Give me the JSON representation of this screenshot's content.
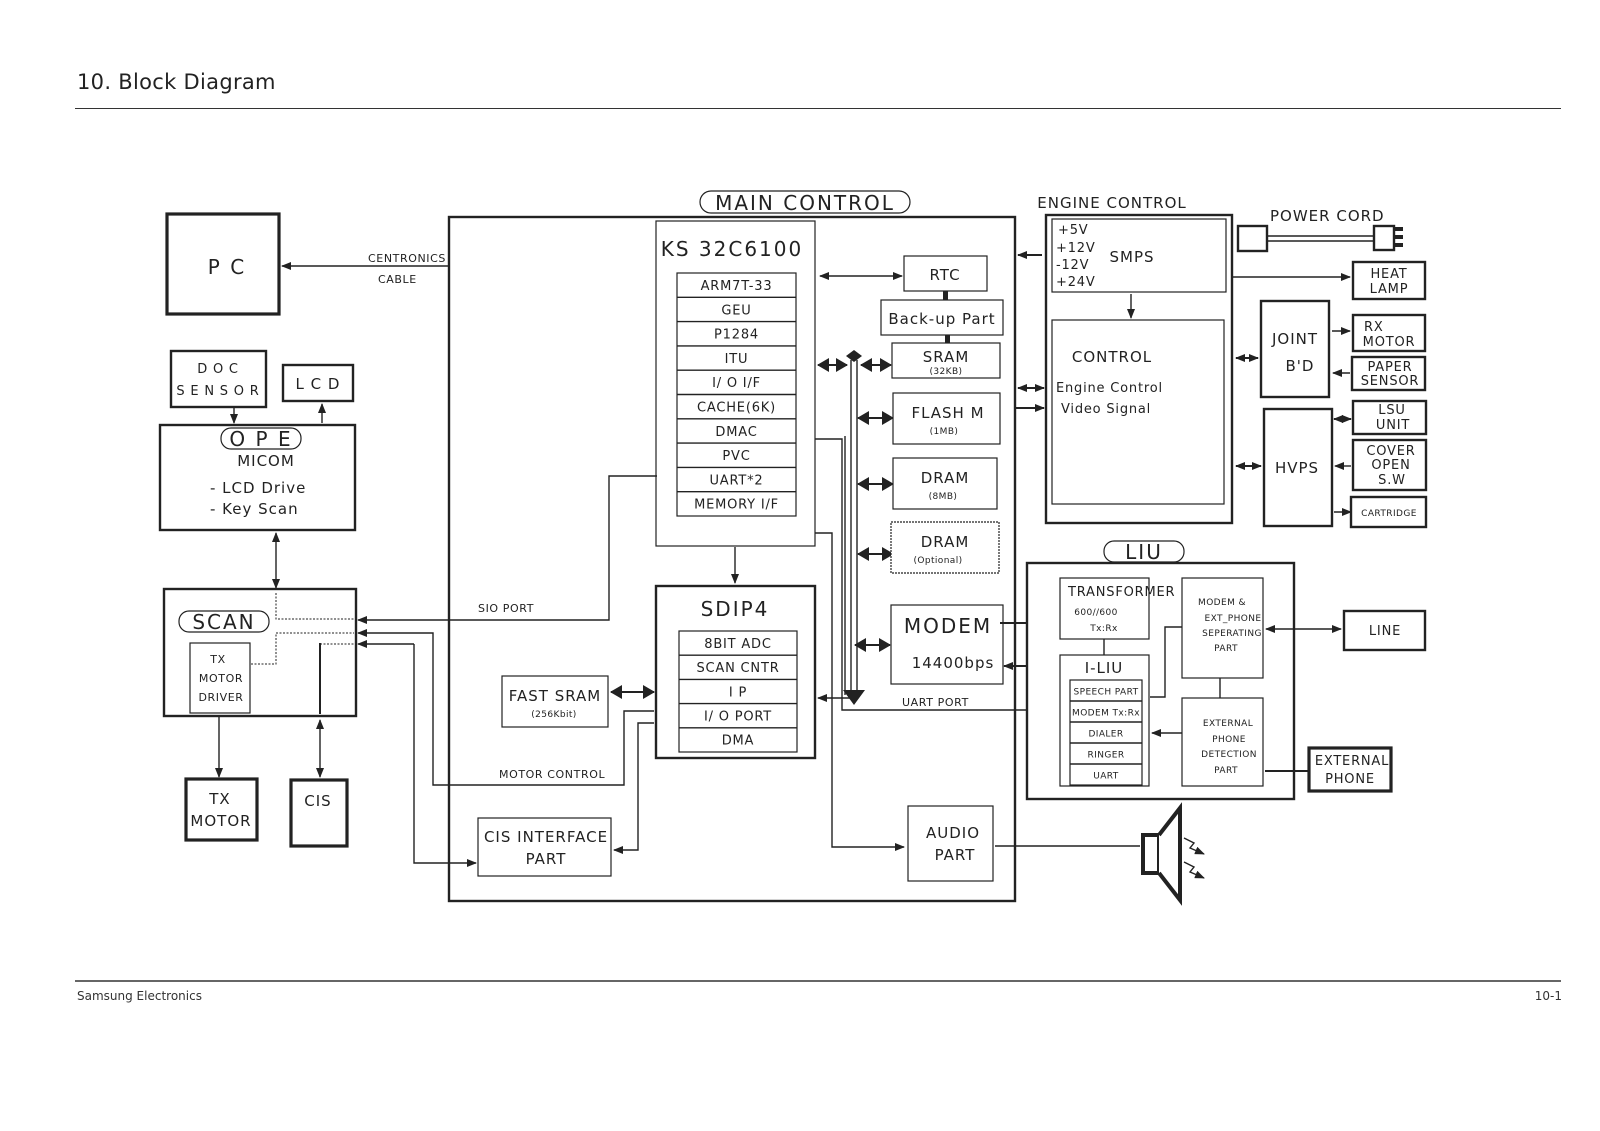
{
  "page": {
    "title": "10.  Block Diagram",
    "footer_left": "Samsung Electronics",
    "footer_right": "10-1"
  },
  "diagram": {
    "pc": "P C",
    "centronics_line1": "CENTRONICS",
    "centronics_line2": "CABLE",
    "doc_sensor_line1": "D O C",
    "doc_sensor_line2": "S E N S O R",
    "lcd": "L C D",
    "ope": {
      "title": "O P E",
      "micom": "MICOM",
      "items": [
        "- LCD  Drive",
        "-  Key Scan"
      ]
    },
    "scan": {
      "title": "SCAN",
      "tx_motor_driver": [
        "TX",
        "MOTOR",
        "DRIVER"
      ]
    },
    "tx_motor": [
      "TX",
      "MOTOR"
    ],
    "cis": "CIS",
    "main_control": {
      "title": "MAIN  CONTROL",
      "cpu": {
        "title": "KS 32C6100",
        "items": [
          "ARM7T-33",
          "GEU",
          "P1284",
          "ITU",
          "I/ O I/F",
          "CACHE(6K)",
          "DMAC",
          "PVC",
          "UART*2",
          "MEMORY I/F"
        ]
      },
      "rtc": "RTC",
      "backup": "Back-up  Part",
      "sram": {
        "title": "SRAM",
        "size": "(32KB)"
      },
      "flash": {
        "title": "FLASH  M",
        "size": "(1MB)"
      },
      "dram": {
        "title": "DRAM",
        "size": "(8MB)"
      },
      "dram_opt": {
        "title": "DRAM",
        "size": "(Optional)"
      },
      "modem": {
        "title": "MODEM",
        "speed": "14400bps"
      },
      "sdip4": {
        "title": "SDIP4",
        "items": [
          "8BIT ADC",
          "SCAN CNTR",
          "I  P",
          "I/ O PORT",
          "DMA"
        ]
      },
      "fast_sram": {
        "title": "FAST  SRAM",
        "size": "(256Kbit)"
      },
      "cis_interface": [
        "CIS INTERFACE",
        "PART"
      ],
      "audio": [
        "AUDIO",
        "PART"
      ],
      "sio_port": "SIO PORT",
      "motor_control": "MOTOR  CONTROL",
      "uart_port": "UART PORT"
    },
    "engine_control": {
      "title": "ENGINE  CONTROL",
      "smps": {
        "title": "SMPS",
        "voltages": [
          "+5V",
          "+12V",
          "-12V",
          "+24V"
        ]
      },
      "control": {
        "title": "CONTROL",
        "lines": [
          "Engine  Control",
          "Video  Signal"
        ]
      }
    },
    "power_cord": "POWER  CORD",
    "heat_lamp": [
      "HEAT",
      "LAMP"
    ],
    "joint_bd": [
      "JOINT",
      "B'D"
    ],
    "rx_motor": [
      "RX",
      "MOTOR"
    ],
    "paper_sensor": [
      "PAPER",
      "SENSOR"
    ],
    "hvps": "HVPS",
    "lsu_unit": [
      "LSU",
      "UNIT"
    ],
    "cover_open": [
      "COVER",
      "OPEN",
      "S.W"
    ],
    "cartridge": "CARTRIDGE",
    "liu": {
      "title": "LIU",
      "transformer": [
        "TRANSFORMER",
        "600//600",
        "Tx:Rx"
      ],
      "iliu": {
        "title": "I-LIU",
        "items": [
          "SPEECH PART",
          "MODEM Tx:Rx",
          "DIALER",
          "RINGER",
          "UART"
        ]
      },
      "separating": [
        "MODEM &",
        "EXT_PHONE",
        "SEPERATING",
        "PART"
      ],
      "ext_detect": [
        "EXTERNAL",
        "PHONE",
        "DETECTION",
        "PART"
      ]
    },
    "line": "LINE",
    "external_phone": [
      "EXTERNAL",
      "PHONE"
    ]
  }
}
